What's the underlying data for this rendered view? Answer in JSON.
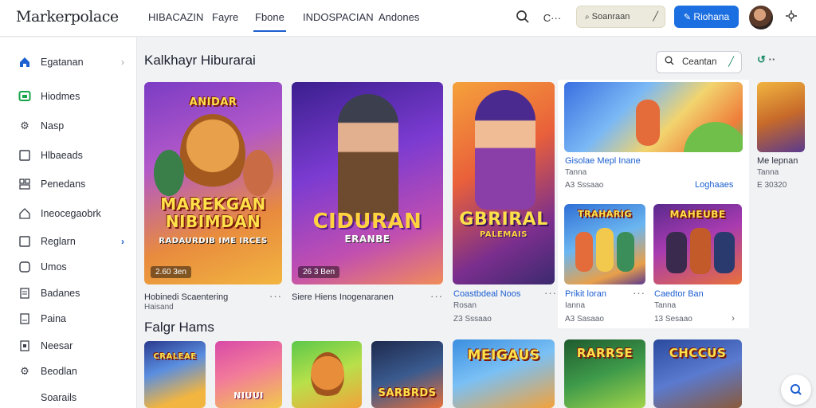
{
  "app": {
    "logo_text": "Markerpolace",
    "accent": "#1c6fe0"
  },
  "topnav": {
    "tabs": [
      {
        "label": "HIBACAZIN"
      },
      {
        "label": "Fayre"
      },
      {
        "label": "Fbone"
      },
      {
        "label": "INDOSPACIAN"
      },
      {
        "label": "Andones"
      }
    ],
    "active_index": 2,
    "search_icon": "search-icon",
    "more_label": "C···",
    "search_box_label": "Soanraan",
    "primary_button_label": "Riohana"
  },
  "sidebar": {
    "items": [
      {
        "label": "Egatanan",
        "icon": "home-icon"
      },
      {
        "label": "Hiodmes",
        "icon": "monitor-icon"
      },
      {
        "label": "Nasp",
        "icon": "gear-icon"
      },
      {
        "label": "Hlbaeads",
        "icon": "square-icon"
      },
      {
        "label": "Penedans",
        "icon": "grid-icon"
      },
      {
        "label": "Ineocegaobrk",
        "icon": "house-icon"
      },
      {
        "label": "Reglarn",
        "icon": "square-icon"
      },
      {
        "label": "Umos",
        "icon": "square-icon"
      },
      {
        "label": "Badanes",
        "icon": "doc-icon"
      },
      {
        "label": "Paina",
        "icon": "doc-icon"
      },
      {
        "label": "Neesar",
        "icon": "doc-icon"
      },
      {
        "label": "Beodlan",
        "icon": "gear-icon"
      },
      {
        "label": "Soarails",
        "icon": ""
      }
    ]
  },
  "main": {
    "section1_title": "Kalkhayr Hiburarai",
    "filter_label": "Ceantan",
    "section2_title": "Falgr Hams",
    "featured": [
      {
        "art_title_1": "ANIDAR",
        "art_title_2": "MAREKGAN NIBIMDAN",
        "art_title_3": "RADAURDIB IME IRCES",
        "price": "2.60 3en",
        "name": "Hobinedi Scaentering",
        "sub": "Haisand"
      },
      {
        "art_title_1": "CIDURAN",
        "art_title_2": "ERANBE",
        "price": "26 3 Ben",
        "name": "Siere Hiens Inogenaranen"
      },
      {
        "art_title_1": "GBRIRAL",
        "art_title_2": "PALEMAIS",
        "name": "Coastbdeal Noos",
        "sub": "Rosan",
        "price": "Z3 Sssaao"
      }
    ],
    "right_cards": [
      {
        "name": "Gisolae Mepl Inane",
        "sub": "Tanna",
        "price": "A3 Sssaao",
        "action": "Loghaaes"
      },
      {
        "name": "Me lepnan",
        "sub": "Tanna",
        "price": "E 30320"
      },
      {
        "art_title": "TRAHARIG",
        "name": "Prikit loran",
        "sub": "Ianna",
        "price": "A3 Sasaao"
      },
      {
        "art_title": "MAHEUBE",
        "name": "Caedtor Ban",
        "sub": "Tanna",
        "price": "13 Sesaao"
      }
    ],
    "bottom_cards": [
      {
        "art_title": "CRALEAE"
      },
      {
        "art_title": "NIUUI"
      },
      {
        "art_title": ""
      },
      {
        "art_title": "SARBRDS"
      },
      {
        "art_title": "MEIGAUS"
      },
      {
        "art_title": "RARRSE"
      },
      {
        "art_title": "CHCCUS"
      }
    ]
  }
}
